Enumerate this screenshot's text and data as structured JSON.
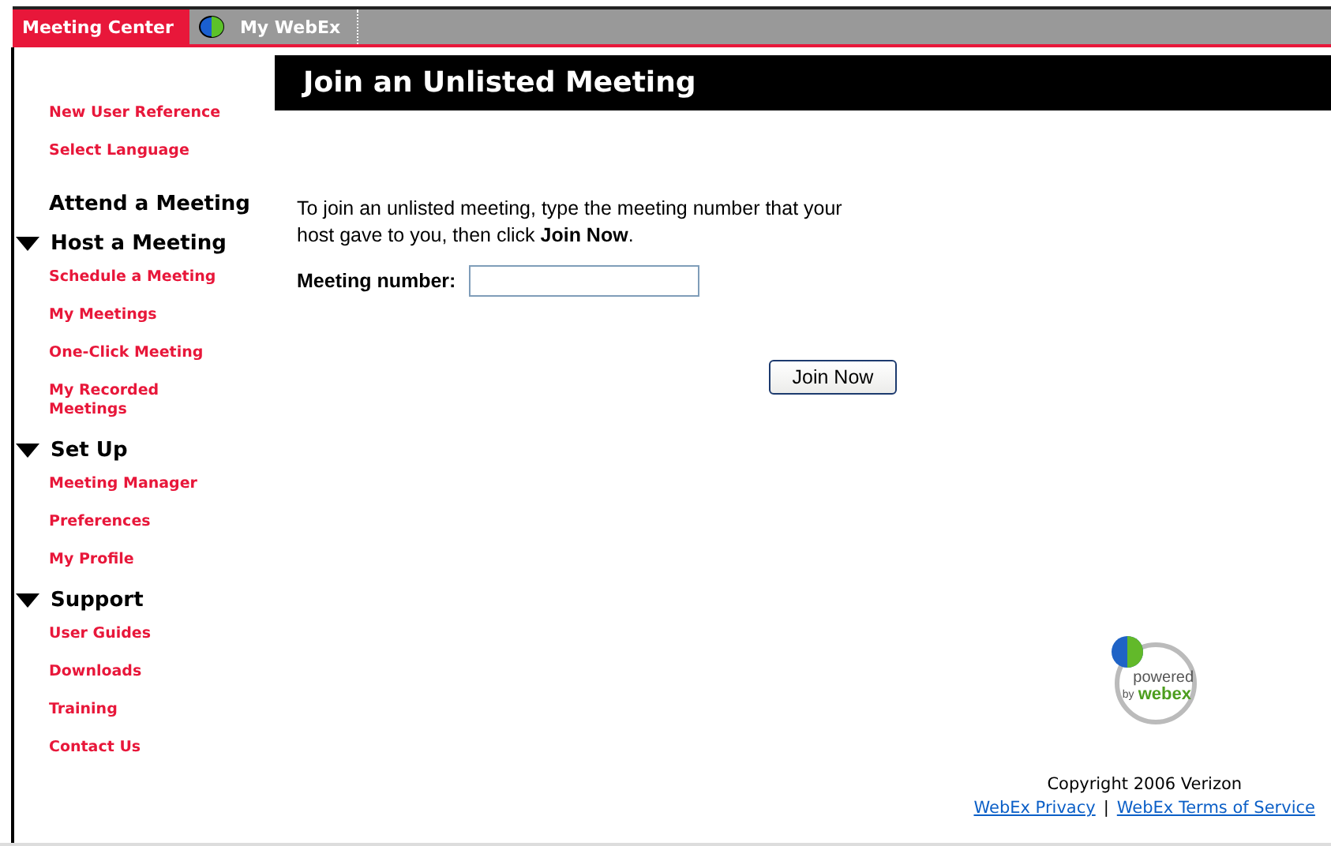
{
  "tabs": [
    {
      "kind": "text",
      "label": "Meeting Center",
      "selected": true
    },
    {
      "kind": "globe",
      "label": "My WebEx",
      "selected": false
    }
  ],
  "sidebar": {
    "items": [
      {
        "kind": "link",
        "label": "New User Reference"
      },
      {
        "kind": "link",
        "label": "Select Language"
      },
      {
        "kind": "heading",
        "label": "Attend a Meeting"
      },
      {
        "kind": "section",
        "label": "Host a Meeting",
        "expanded": true,
        "children": [
          {
            "label": "Schedule a Meeting"
          },
          {
            "label": "My Meetings"
          },
          {
            "label": "One-Click Meeting"
          },
          {
            "label": "My Recorded Meetings"
          }
        ]
      },
      {
        "kind": "section",
        "label": "Set Up",
        "expanded": true,
        "children": [
          {
            "label": "Meeting Manager"
          },
          {
            "label": "Preferences"
          },
          {
            "label": "My Profile"
          }
        ]
      },
      {
        "kind": "section",
        "label": "Support",
        "expanded": true,
        "children": [
          {
            "label": "User Guides"
          },
          {
            "label": "Downloads"
          },
          {
            "label": "Training"
          },
          {
            "label": "Contact Us"
          }
        ]
      }
    ]
  },
  "main": {
    "title": "Join an Unlisted Meeting",
    "instructions": "To join an unlisted meeting, type the meeting number that your host gave to you, then click **Join Now**.",
    "field": {
      "label": "Meeting number:"
    },
    "button": "Join Now"
  },
  "footer": {
    "logo": {
      "line1": "powered",
      "line2": "by",
      "line3": "webex"
    },
    "copyright": "Copyright 2006 Verizon",
    "links": [
      "WebEx Privacy",
      "WebEx Terms of Service"
    ],
    "separator": "|"
  }
}
